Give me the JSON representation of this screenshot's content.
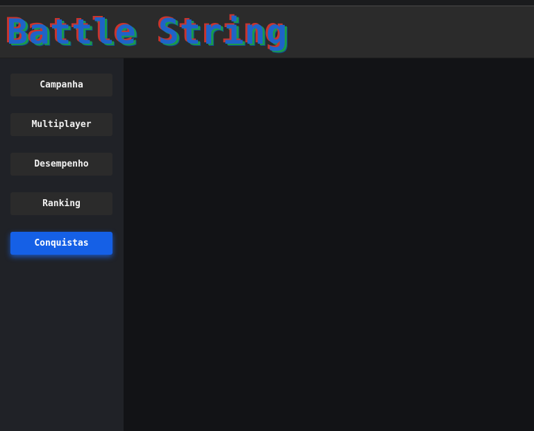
{
  "app": {
    "title": "Battle String"
  },
  "sidebar": {
    "items": [
      {
        "label": "Campanha",
        "active": false
      },
      {
        "label": "Multiplayer",
        "active": false
      },
      {
        "label": "Desempenho",
        "active": false
      },
      {
        "label": "Ranking",
        "active": false
      },
      {
        "label": "Conquistas",
        "active": true
      }
    ]
  },
  "colors": {
    "accent": "#1560e6",
    "header_bg": "#2b2b2b",
    "sidebar_bg": "#202227",
    "main_bg": "#121316",
    "button_bg": "#2b2b2b",
    "logo_blue": "#1f63c8",
    "logo_red": "#c8352e",
    "logo_green": "#1a9a4a"
  }
}
